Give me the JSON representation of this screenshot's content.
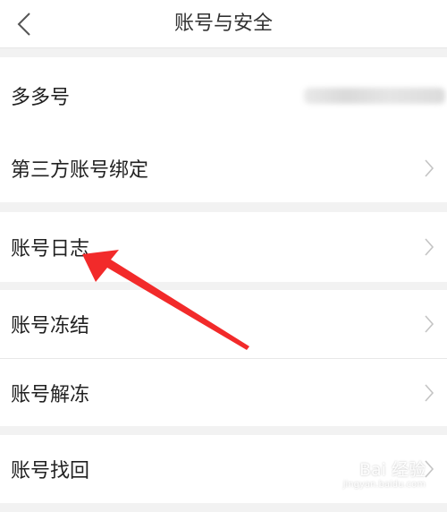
{
  "header": {
    "title": "账号与安全",
    "back_icon": "chevron-left-icon"
  },
  "groups": [
    {
      "items": [
        {
          "label": "多多号",
          "value_obscured": true
        }
      ]
    },
    {
      "items": [
        {
          "label": "第三方账号绑定"
        }
      ]
    },
    {
      "items": [
        {
          "label": "账号日志"
        }
      ]
    },
    {
      "items": [
        {
          "label": "账号冻结"
        },
        {
          "label": "账号解冻"
        }
      ]
    },
    {
      "items": [
        {
          "label": "账号找回"
        }
      ]
    }
  ],
  "annotation": {
    "color": "#f22a2a",
    "target": "账号日志"
  },
  "watermark": {
    "text": "Bai 经验",
    "url": "jingyan.baidu.com"
  }
}
